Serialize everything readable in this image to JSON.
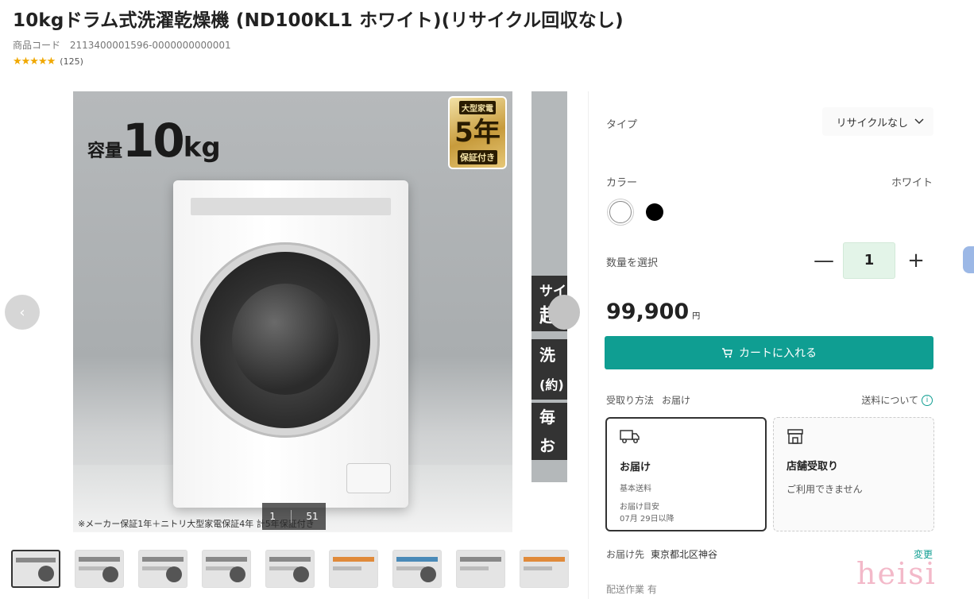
{
  "product": {
    "title": "10kgドラム式洗濯乾燥機 (ND100KL1 ホワイト)(リサイクル回収なし)",
    "code_label": "商品コード",
    "code_value": "2113400001596-0000000000001",
    "stars": "★★★★★",
    "review_count": "(125)"
  },
  "gallery": {
    "capacity_small": "容量",
    "capacity_big": "10",
    "capacity_unit": "kg",
    "warranty_top": "大型家電",
    "warranty_year": "5年",
    "warranty_bottom": "保証付き",
    "caption": "※メーカー保証1年＋ニトリ大型家電保証4年 計5年保証付き",
    "counter_current": "1",
    "counter_total": "51",
    "prev_icon": "‹",
    "side_text_1": "サイ",
    "side_text_2": "超",
    "side_text_3": "洗",
    "side_text_4": "(約)",
    "side_text_5": "毎回",
    "side_text_6": "お"
  },
  "options": {
    "type_label": "タイプ",
    "type_value": "リサイクルなし",
    "color_label": "カラー",
    "color_value": "ホワイト",
    "qty_label": "数量を選択",
    "qty_value": "1",
    "minus": "—",
    "plus": "+"
  },
  "pricing": {
    "price": "99,900",
    "yen": "円",
    "cart_label": "カートに入れる"
  },
  "delivery": {
    "method_label": "受取り方法",
    "method_value": "お届け",
    "shipping_link": "送料について",
    "card1_title": "お届け",
    "card1_sub": "基本送料",
    "card1_note_1": "お届け目安",
    "card1_note_2": "07月 29日以降",
    "card2_title": "店舗受取り",
    "card2_sub": "ご利用できません",
    "dest_label": "お届け先",
    "dest_value": "東京都北区神谷",
    "change_label": "変更",
    "cut_text": "配送作業 有"
  },
  "watermark": "heisi",
  "colors": {
    "accent": "#0f9e92",
    "star": "#f0a800",
    "qty_bg": "#e3f4e8"
  }
}
